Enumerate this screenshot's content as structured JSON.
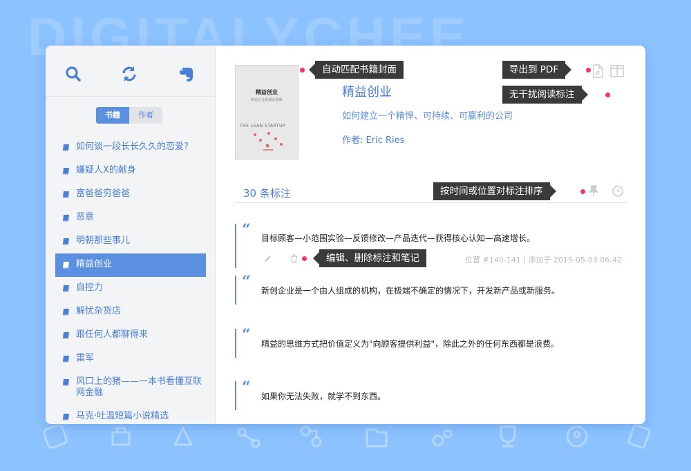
{
  "watermark": "DIGITALYCHEE",
  "sidebar": {
    "tools": [
      {
        "name": "search-icon"
      },
      {
        "name": "sync-icon"
      },
      {
        "name": "evernote-icon"
      }
    ],
    "toggle": {
      "books_label": "书籍",
      "authors_label": "作者",
      "selected": "books"
    },
    "books": [
      {
        "title": "如何谈一段长长久久的恋爱?"
      },
      {
        "title": "嫌疑人X的献身"
      },
      {
        "title": "富爸爸穷爸爸"
      },
      {
        "title": "恶意"
      },
      {
        "title": "明朝那些事儿"
      },
      {
        "title": "精益创业",
        "active": true
      },
      {
        "title": "自控力"
      },
      {
        "title": "解忧杂货店"
      },
      {
        "title": "跟任何人都聊得来"
      },
      {
        "title": "雷军"
      },
      {
        "title": "风口上的猪——一本书看懂互联网金融"
      },
      {
        "title": "马克·吐温短篇小说精选"
      }
    ]
  },
  "book": {
    "cover": {
      "title": "精益创业",
      "subtitle": "新创企业的成长思维",
      "english": "THE LEAN STARTUP"
    },
    "title": "精益创业",
    "subtitle": "如何建立一个精悍、可持续、可赢利的公司",
    "author": "作者: Eric Ries"
  },
  "notes": {
    "count_label": "30 条标注",
    "items": [
      {
        "text": "目标顾客—小范围实验—反馈修改—产品迭代—获得核心认知—高速增长。",
        "meta": "位置 #140-141 | 添加于 2015-05-03 06:42"
      },
      {
        "text": "新创企业是一个由人组成的机构，在极端不确定的情况下，开发新产品或新服务。"
      },
      {
        "text": "精益的思维方式把价值定义为\"向顾客提供利益\"，除此之外的任何东西都是浪费。"
      },
      {
        "text": "如果你无法失败，就学不到东西。"
      }
    ]
  },
  "callouts": {
    "cover": "自动匹配书籍封面",
    "export": "导出到 PDF",
    "reader": "无干扰阅读标注",
    "sort": "按时间或位置对标注排序",
    "edit": "编辑、删除标注和笔记"
  },
  "colors": {
    "accent": "#5b8fe0",
    "callout_bg": "#3a3a3a",
    "dot": "#ff2f6e",
    "background": "#8cc3ff"
  }
}
